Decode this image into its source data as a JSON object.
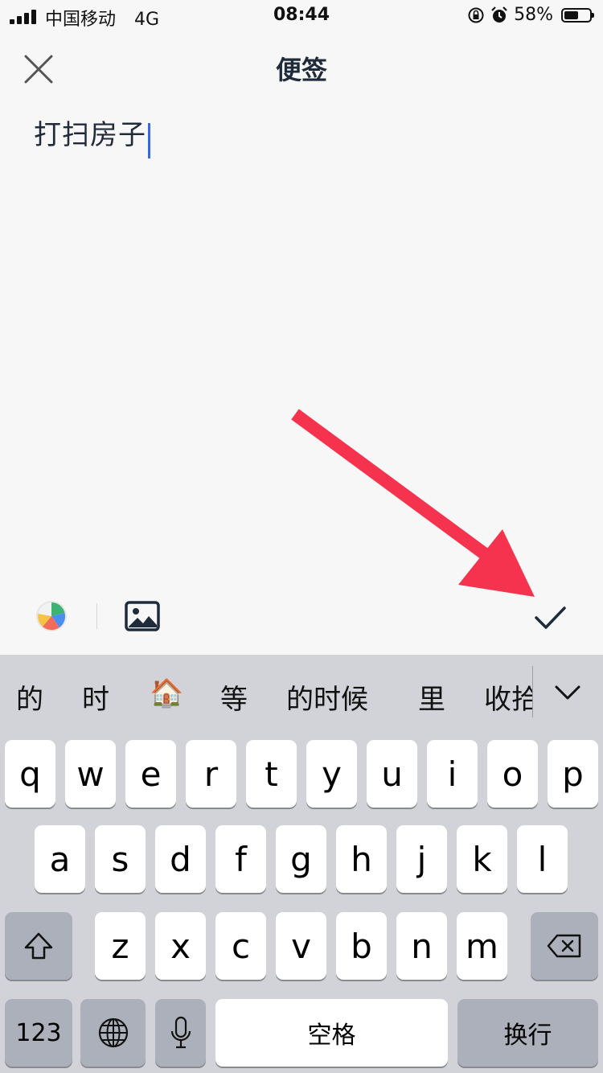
{
  "status_bar": {
    "carrier": "中国移动",
    "network": "4G",
    "time": "08:44",
    "battery_text": "58%",
    "battery_level": 0.58
  },
  "header": {
    "title": "便签",
    "close_icon": "close-icon"
  },
  "note": {
    "content": "打扫房子"
  },
  "toolbar": {
    "color_icon": "color-palette-icon",
    "image_icon": "image-icon",
    "done_icon": "checkmark-icon"
  },
  "keyboard": {
    "suggestions": [
      "的",
      "时",
      "🏠",
      "等",
      "的时候",
      "里",
      "收拾"
    ],
    "collapse_icon": "chevron-down-icon",
    "row1": [
      "q",
      "w",
      "e",
      "r",
      "t",
      "y",
      "u",
      "i",
      "o",
      "p"
    ],
    "row2": [
      "a",
      "s",
      "d",
      "f",
      "g",
      "h",
      "j",
      "k",
      "l"
    ],
    "row3": [
      "z",
      "x",
      "c",
      "v",
      "b",
      "n",
      "m"
    ],
    "numbers_label": "123",
    "space_label": "空格",
    "return_label": "换行"
  },
  "colors": {
    "accent_caret": "#3a66e0",
    "annotation_arrow": "#f5334e",
    "title_text": "#1f2a3a"
  }
}
